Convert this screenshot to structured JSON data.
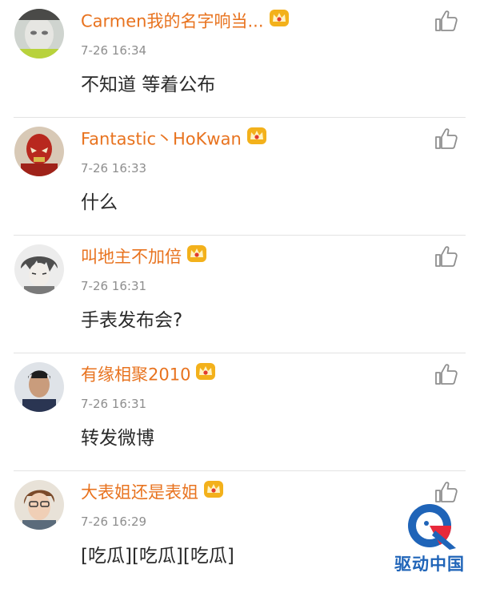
{
  "comments": [
    {
      "username": "Carmen我的名字响当...",
      "time": "7-26 16:34",
      "text": "不知道 等着公布",
      "vip_badge": "crown-badge-icon",
      "like_icon": "thumbs-up-icon"
    },
    {
      "username": "Fantastic丶HoKwan",
      "time": "7-26 16:33",
      "text": "什么",
      "vip_badge": "crown-badge-icon",
      "like_icon": "thumbs-up-icon"
    },
    {
      "username": "叫地主不加倍",
      "time": "7-26 16:31",
      "text": "手表发布会?",
      "vip_badge": "crown-badge-icon",
      "like_icon": "thumbs-up-icon"
    },
    {
      "username": "有缘相聚2010",
      "time": "7-26 16:31",
      "text": "转发微博",
      "vip_badge": "crown-badge-icon",
      "like_icon": "thumbs-up-icon"
    },
    {
      "username": "大表姐还是表姐",
      "time": "7-26 16:29",
      "text": "[吃瓜][吃瓜][吃瓜]",
      "vip_badge": "crown-badge-icon",
      "like_icon": "thumbs-up-icon"
    }
  ],
  "watermark": {
    "text": "驱动中国"
  },
  "colors": {
    "username": "#e8731f",
    "time": "#8e8e8e",
    "text": "#2a2a2a",
    "divider": "#e3e3e3",
    "watermark": "#1f64b8"
  }
}
